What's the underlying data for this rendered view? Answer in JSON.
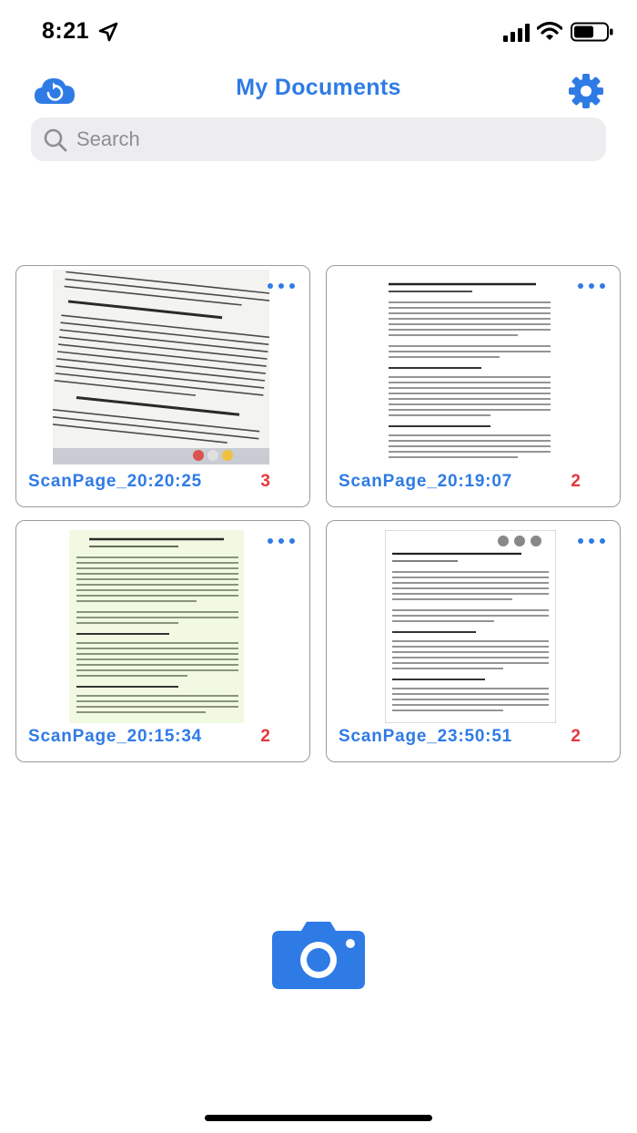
{
  "status_bar": {
    "time": "8:21",
    "icons": [
      "location-arrow-icon",
      "cellular-signal-icon",
      "wifi-icon",
      "battery-icon"
    ]
  },
  "header": {
    "title": "My Documents",
    "left_icon": "cloud-sync-icon",
    "right_icon": "gear-icon"
  },
  "search": {
    "placeholder": "Search",
    "value": ""
  },
  "documents": [
    {
      "name": "ScanPage_20:20:25",
      "page_count": "3"
    },
    {
      "name": "ScanPage_20:19:07",
      "page_count": "2"
    },
    {
      "name": "ScanPage_20:15:34",
      "page_count": "2"
    },
    {
      "name": "ScanPage_23:50:51",
      "page_count": "2"
    }
  ],
  "camera": {
    "icon": "camera-icon"
  },
  "colors": {
    "accent": "#2f7be5",
    "count": "#e5373f",
    "search_bg": "#ededef",
    "card_border": "#9a9a9a"
  }
}
